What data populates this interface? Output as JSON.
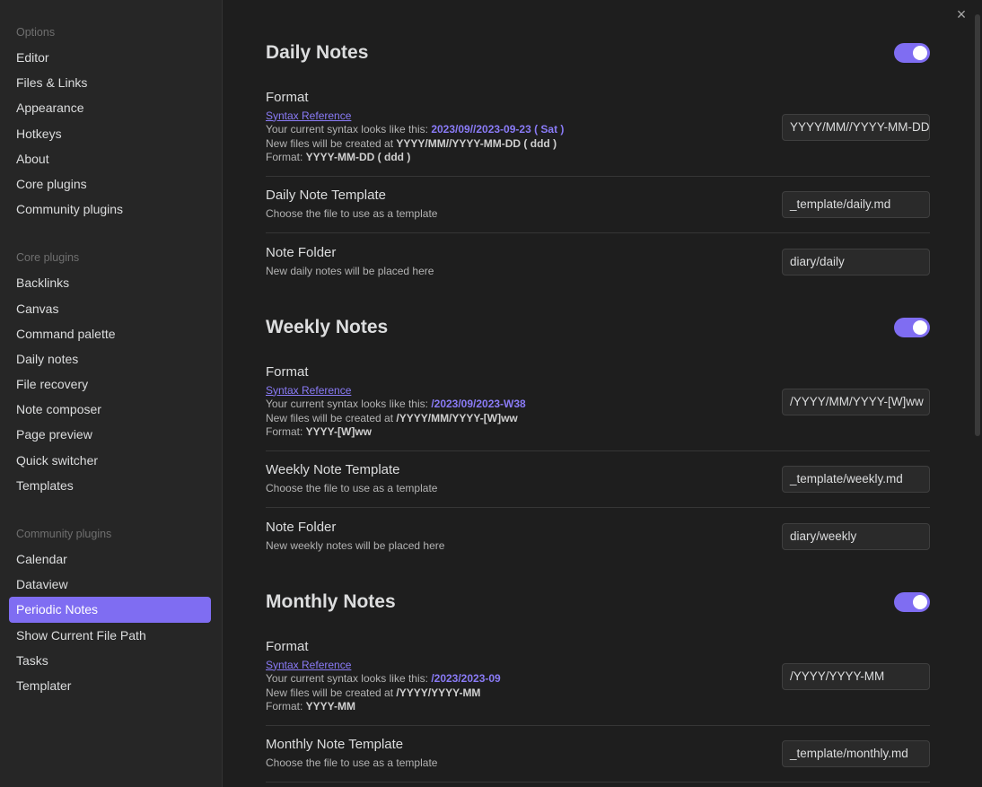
{
  "sidebar": {
    "options_heading": "Options",
    "options": [
      "Editor",
      "Files & Links",
      "Appearance",
      "Hotkeys",
      "About",
      "Core plugins",
      "Community plugins"
    ],
    "core_heading": "Core plugins",
    "core": [
      "Backlinks",
      "Canvas",
      "Command palette",
      "Daily notes",
      "File recovery",
      "Note composer",
      "Page preview",
      "Quick switcher",
      "Templates"
    ],
    "community_heading": "Community plugins",
    "community": [
      "Calendar",
      "Dataview",
      "Periodic Notes",
      "Show Current File Path",
      "Tasks",
      "Templater"
    ],
    "active": "Periodic Notes"
  },
  "close_icon": "×",
  "accent_color": "#7f6df2",
  "sections": {
    "daily": {
      "title": "Daily Notes",
      "enabled": true,
      "format": {
        "name": "Format",
        "syntax_link": "Syntax Reference",
        "current_prefix": "Your current syntax looks like this: ",
        "current_value": "2023/09//2023-09-23 ( Sat )",
        "new_files_prefix": "New files will be created at ",
        "new_files_value": "YYYY/MM//YYYY-MM-DD ( ddd )",
        "format_prefix": "Format: ",
        "format_value": "YYYY-MM-DD ( ddd )",
        "input_value": "YYYY/MM//YYYY-MM-DD"
      },
      "template": {
        "name": "Daily Note Template",
        "desc": "Choose the file to use as a template",
        "value": "_template/daily.md"
      },
      "folder": {
        "name": "Note Folder",
        "desc": "New daily notes will be placed here",
        "value": "diary/daily"
      }
    },
    "weekly": {
      "title": "Weekly Notes",
      "enabled": true,
      "format": {
        "name": "Format",
        "syntax_link": "Syntax Reference",
        "current_prefix": "Your current syntax looks like this: ",
        "current_value": "/2023/09/2023-W38",
        "new_files_prefix": "New files will be created at ",
        "new_files_value": "/YYYY/MM/YYYY-[W]ww",
        "format_prefix": "Format: ",
        "format_value": "YYYY-[W]ww",
        "input_value": "/YYYY/MM/YYYY-[W]ww"
      },
      "template": {
        "name": "Weekly Note Template",
        "desc": "Choose the file to use as a template",
        "value": "_template/weekly.md"
      },
      "folder": {
        "name": "Note Folder",
        "desc": "New weekly notes will be placed here",
        "value": "diary/weekly"
      }
    },
    "monthly": {
      "title": "Monthly Notes",
      "enabled": true,
      "format": {
        "name": "Format",
        "syntax_link": "Syntax Reference",
        "current_prefix": "Your current syntax looks like this: ",
        "current_value": "/2023/2023-09",
        "new_files_prefix": "New files will be created at ",
        "new_files_value": "/YYYY/YYYY-MM",
        "format_prefix": "Format: ",
        "format_value": "YYYY-MM",
        "input_value": "/YYYY/YYYY-MM"
      },
      "template": {
        "name": "Monthly Note Template",
        "desc": "Choose the file to use as a template",
        "value": "_template/monthly.md"
      }
    }
  }
}
